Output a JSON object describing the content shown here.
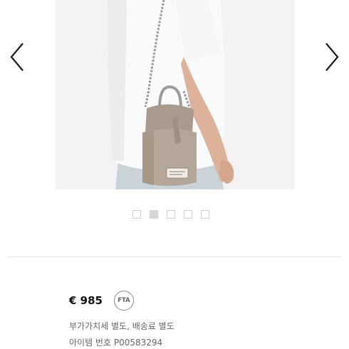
{
  "gallery": {
    "prev_icon": "chevron-left-icon",
    "next_icon": "chevron-right-icon",
    "slide_count": 5,
    "active_slide": 2
  },
  "product": {
    "price": "€ 985",
    "fta_badge": "FTA",
    "tax_note": "부가가치세 별도, 배송료 별도",
    "item_number": "아이템 번호 P00583294"
  },
  "colors": {
    "bag": "#b4a699",
    "shirt": "#fafafa",
    "skin": "#dcb29b",
    "jeans": "#c9d3d8",
    "dot_active": "#d6d6d6"
  }
}
